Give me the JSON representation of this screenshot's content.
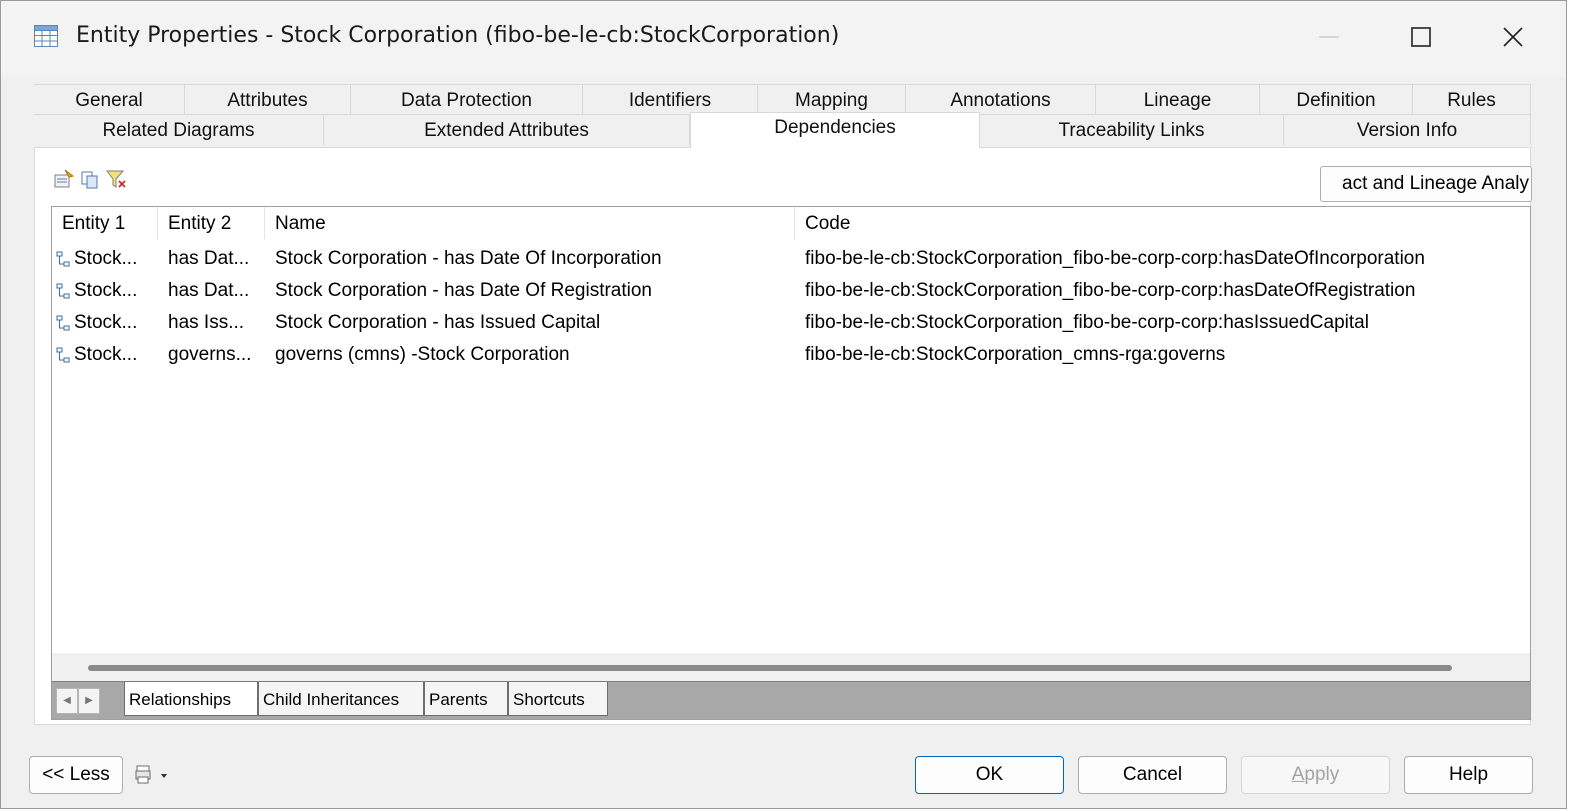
{
  "window": {
    "title": "Entity Properties - Stock Corporation (fibo-be-le-cb:StockCorporation)"
  },
  "tabs_row1": [
    "General",
    "Attributes",
    "Data Protection",
    "Identifiers",
    "Mapping",
    "Annotations",
    "Lineage",
    "Definition",
    "Rules"
  ],
  "tabs_row2": [
    "Related Diagrams",
    "Extended Attributes",
    "Dependencies",
    "Traceability Links",
    "Version Info"
  ],
  "active_tab": "Dependencies",
  "toolbar": {
    "icons": [
      "properties-icon",
      "copy-icon",
      "filter-icon"
    ],
    "impact_button_label": "act and Lineage Analy"
  },
  "table": {
    "columns": [
      "Entity 1",
      "Entity 2",
      "Name",
      "Code"
    ],
    "rows": [
      {
        "entity1": "Stock...",
        "entity2": "has Dat...",
        "name": "Stock Corporation - has Date Of Incorporation",
        "code": "fibo-be-le-cb:StockCorporation_fibo-be-corp-corp:hasDateOfIncorporation"
      },
      {
        "entity1": "Stock...",
        "entity2": "has Dat...",
        "name": "Stock Corporation - has Date Of Registration",
        "code": "fibo-be-le-cb:StockCorporation_fibo-be-corp-corp:hasDateOfRegistration"
      },
      {
        "entity1": "Stock...",
        "entity2": "has Iss...",
        "name": "Stock Corporation - has Issued Capital",
        "code": "fibo-be-le-cb:StockCorporation_fibo-be-corp-corp:hasIssuedCapital"
      },
      {
        "entity1": "Stock...",
        "entity2": "governs...",
        "name": "governs (cmns) -Stock Corporation",
        "code": "fibo-be-le-cb:StockCorporation_cmns-rga:governs"
      }
    ]
  },
  "subtabs": [
    "Relationships",
    "Child Inheritances",
    "Parents",
    "Shortcuts"
  ],
  "active_subtab": "Relationships",
  "buttons": {
    "less": "<< Less",
    "ok": "OK",
    "cancel": "Cancel",
    "apply_prefix": "A",
    "apply_rest": "pply",
    "help": "Help"
  }
}
